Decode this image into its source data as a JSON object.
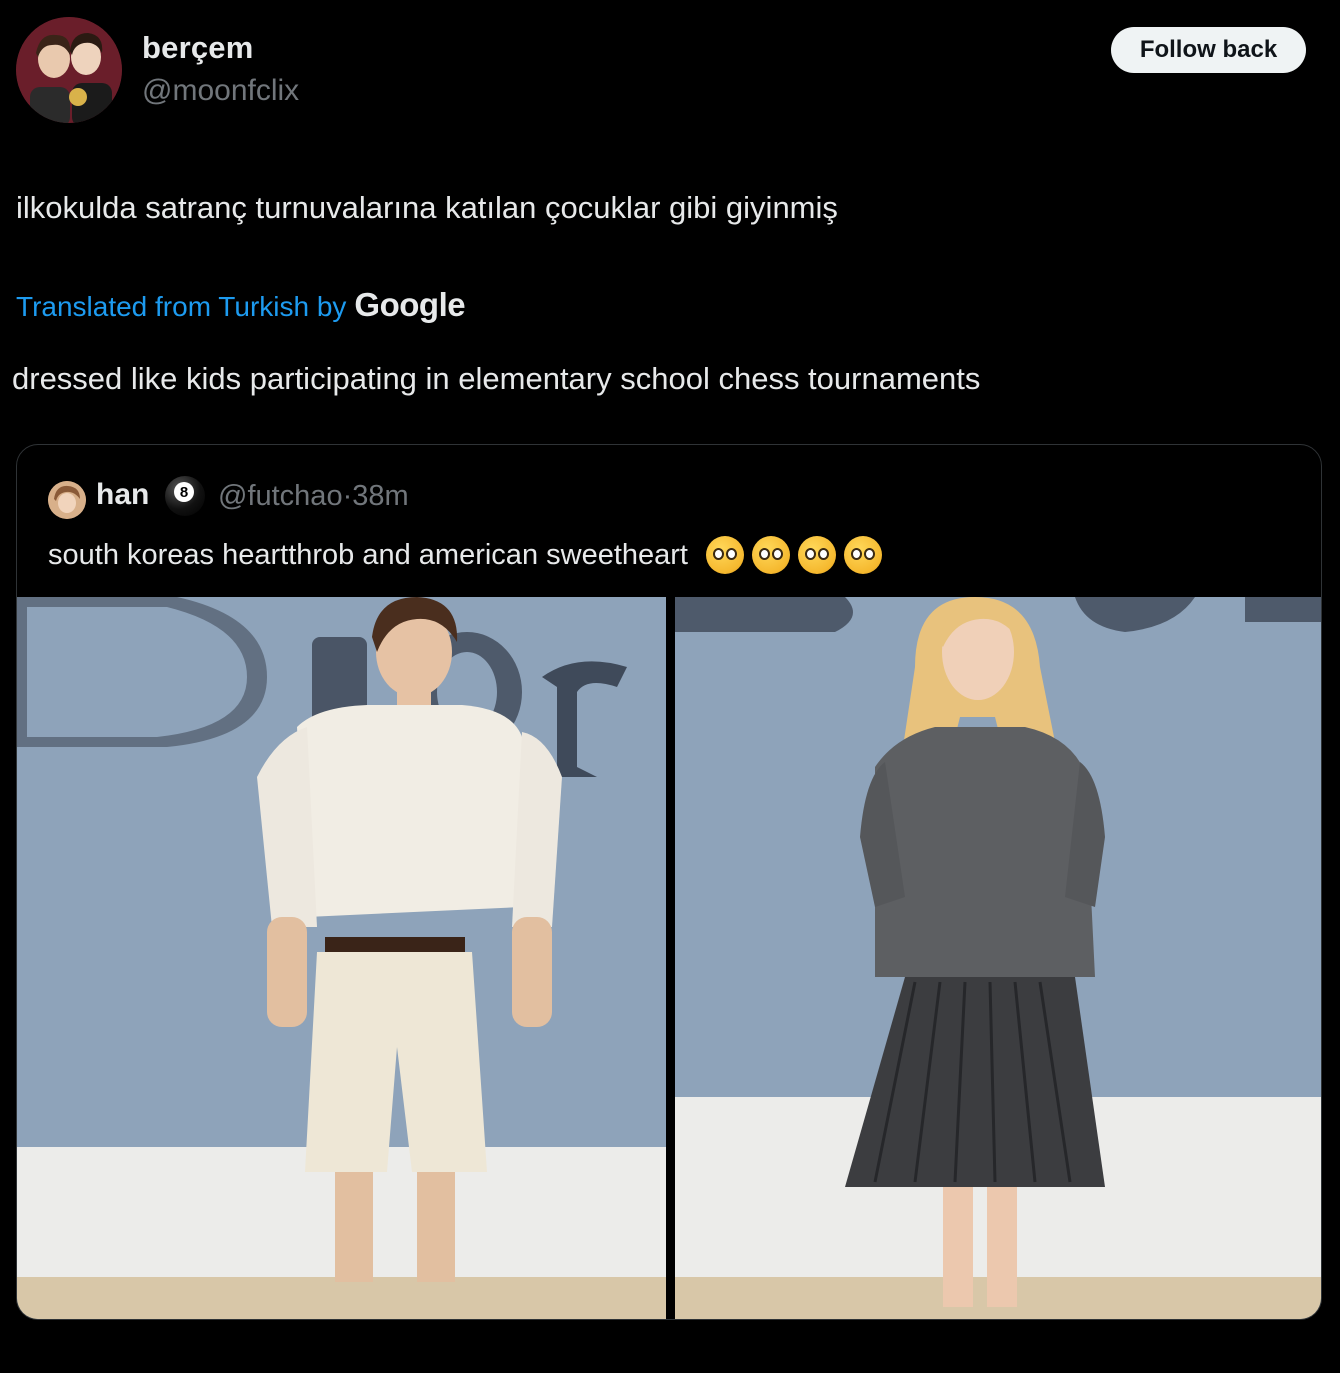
{
  "author": {
    "display_name": "berçem",
    "handle": "@moonfclix",
    "follow_button": "Follow back"
  },
  "tweet": {
    "text": "ilkokulda satranç turnuvalarına katılan çocuklar gibi giyinmiş",
    "translated_label": "Translated from Turkish by",
    "translator": "Google",
    "translation": "dressed like kids participating in elementary school chess tournaments"
  },
  "quoted": {
    "name": "han",
    "badge": "8",
    "handle": "@futchao",
    "separator": "·",
    "time": "38m",
    "text": "south koreas heartthrob and american sweetheart",
    "emojis": [
      "pleading-face",
      "pleading-face",
      "pleading-face",
      "pleading-face"
    ],
    "images": [
      "man-white-shirt-shorts-dior",
      "woman-grey-blazer-pleated-skirt-dior"
    ]
  },
  "colors": {
    "background": "#000000",
    "text": "#e7e9ea",
    "muted": "#71767b",
    "link": "#1d9bf0",
    "border": "#2f3336",
    "wall": "#8aa0b8"
  }
}
